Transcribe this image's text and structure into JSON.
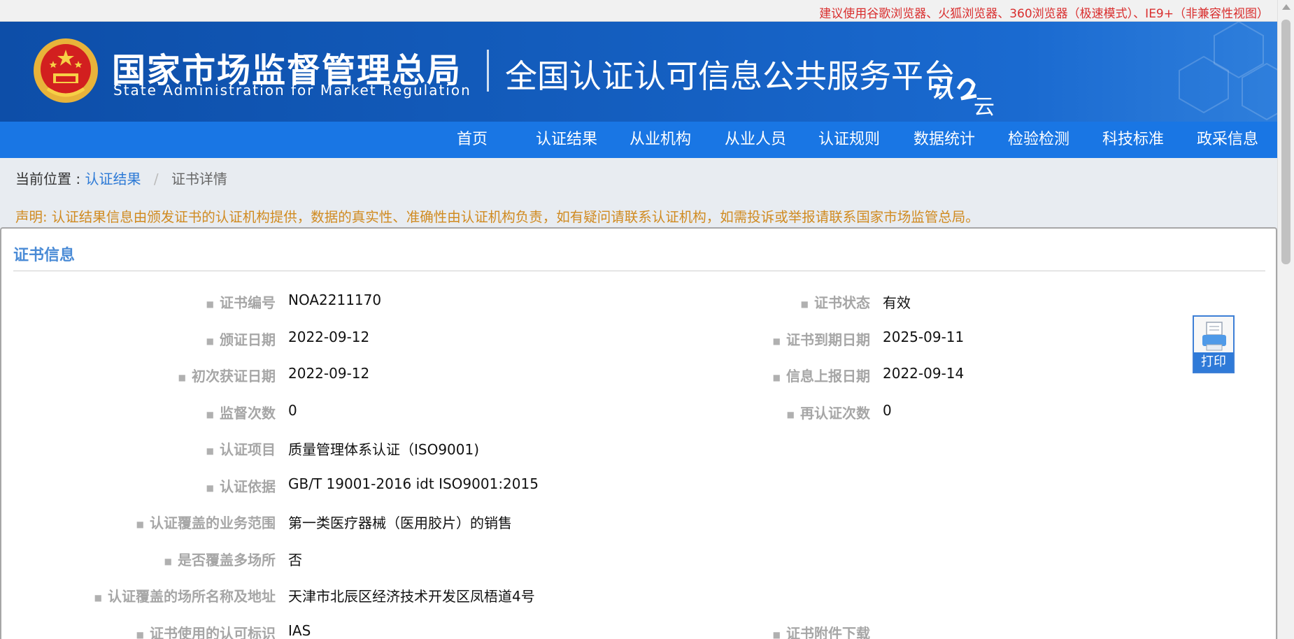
{
  "browser_notice": "建议使用谷歌浏览器、火狐浏览器、360浏览器（极速模式）、IE9+（非兼容性视图）",
  "header": {
    "org_name_cn": "国家市场监督管理总局",
    "org_name_en": "State Administration  for  Market Regulation",
    "platform_title": "全国认证认可信息公共服务平台",
    "logo_text": "认云"
  },
  "nav": {
    "items": [
      "首页",
      "认证结果",
      "从业机构",
      "从业人员",
      "认证规则",
      "数据统计",
      "检验检测",
      "科技标准",
      "政采信息"
    ]
  },
  "breadcrumb": {
    "prefix": "当前位置 :",
    "link": "认证结果",
    "separator": "/",
    "current": "证书详情"
  },
  "declaration": "声明: 认证结果信息由颁发证书的认证机构提供，数据的真实性、准确性由认证机构负责，如有疑问请联系认证机构，如需投诉或举报请联系国家市场监管总局。",
  "card": {
    "title": "证书信息",
    "left_fields": [
      {
        "label": "证书编号",
        "value": "NOA2211170"
      },
      {
        "label": "颁证日期",
        "value": "2022-09-12"
      },
      {
        "label": "初次获证日期",
        "value": "2022-09-12"
      },
      {
        "label": "监督次数",
        "value": "0"
      },
      {
        "label": "认证项目",
        "value": "质量管理体系认证（ISO9001)"
      },
      {
        "label": "认证依据",
        "value": "GB/T 19001-2016 idt ISO9001:2015"
      },
      {
        "label": "认证覆盖的业务范围",
        "value": "第一类医疗器械（医用胶片）的销售"
      },
      {
        "label": "是否覆盖多场所",
        "value": "否"
      },
      {
        "label": "认证覆盖的场所名称及地址",
        "value": "天津市北辰区经济技术开发区凤梧道4号"
      },
      {
        "label": "证书使用的认可标识",
        "value": "IAS"
      }
    ],
    "right_fields": [
      {
        "label": "证书状态",
        "value": "有效"
      },
      {
        "label": "证书到期日期",
        "value": "2025-09-11"
      },
      {
        "label": "信息上报日期",
        "value": "2022-09-14"
      },
      {
        "label": "再认证次数",
        "value": "0"
      },
      {
        "label": "证书附件下载",
        "value": ""
      }
    ],
    "print_label": "打印"
  }
}
